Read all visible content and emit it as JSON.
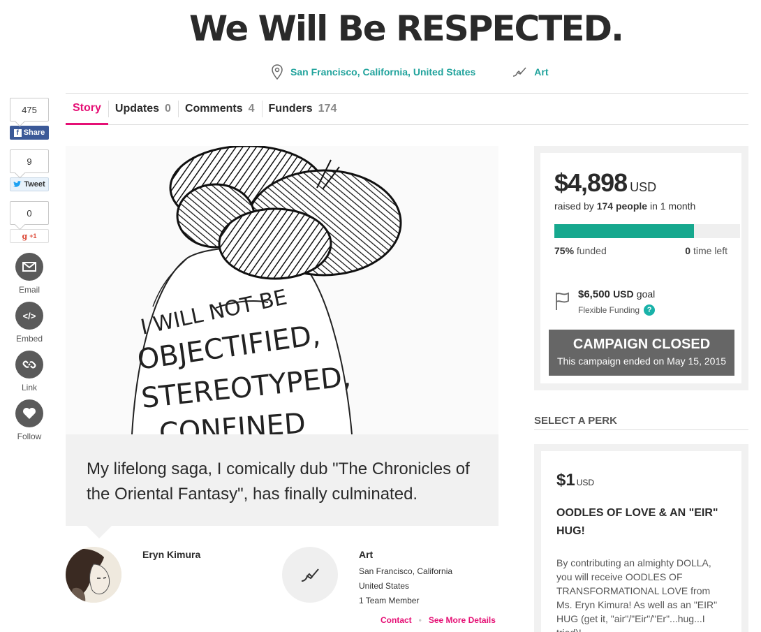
{
  "campaign": {
    "title": "We Will Be RESPECTED.",
    "location": "San Francisco, California, United States",
    "category": "Art"
  },
  "social": {
    "facebook": {
      "count": "475",
      "label": "Share"
    },
    "twitter": {
      "count": "9",
      "label": "Tweet"
    },
    "gplus": {
      "count": "0",
      "label": "+1"
    },
    "email_label": "Email",
    "embed_label": "Embed",
    "link_label": "Link",
    "follow_label": "Follow"
  },
  "tabs": [
    {
      "label": "Story",
      "count": ""
    },
    {
      "label": "Updates",
      "count": "0"
    },
    {
      "label": "Comments",
      "count": "4"
    },
    {
      "label": "Funders",
      "count": "174"
    }
  ],
  "hero_image": {
    "text_lines": [
      "I WILL NOT BE",
      "OBJECTIFIED,",
      "STEREOTYPED,",
      "CONFINED"
    ]
  },
  "quote": "My lifelong saga, I comically dub \"The Chronicles of the Oriental Fantasy\", has finally culminated.",
  "owner": {
    "name": "Eryn Kimura"
  },
  "category_card": {
    "title": "Art",
    "line1": "San Francisco, California",
    "line2": "United States",
    "line3": "1 Team Member"
  },
  "links": {
    "contact": "Contact",
    "dot": "•",
    "details": "See More Details"
  },
  "funding": {
    "amount": "$4,898",
    "currency": "USD",
    "raised_prefix": "raised by",
    "people": "174 people",
    "raised_suffix": "in 1 month",
    "percent_funded": 0.75,
    "funded_bold": "75%",
    "funded_text": "funded",
    "time_bold": "0",
    "time_text": "time left",
    "goal_amount": "$6,500",
    "goal_currency": "USD",
    "goal_text": "goal",
    "flexible_label": "Flexible Funding",
    "help_label": "?",
    "closed_title": "CAMPAIGN CLOSED",
    "closed_subtitle": "This campaign ended on May 15, 2015",
    "bar_color": "#16a88e"
  },
  "perks": {
    "heading": "SELECT A PERK",
    "items": [
      {
        "price": "$1",
        "currency": "USD",
        "title": "OODLES OF LOVE & AN \"EIR\" HUG!",
        "description": "By contributing an almighty DOLLA, you will receive OODLES OF TRANSFORMATIONAL LOVE from Ms. Eryn Kimura! As well as an \"EIR\" HUG (get it, \"air\"/\"Eir\"/\"Er\"...hug...I tried)!"
      }
    ]
  },
  "colors": {
    "accent": "#e51075",
    "teal": "#21a39c"
  }
}
